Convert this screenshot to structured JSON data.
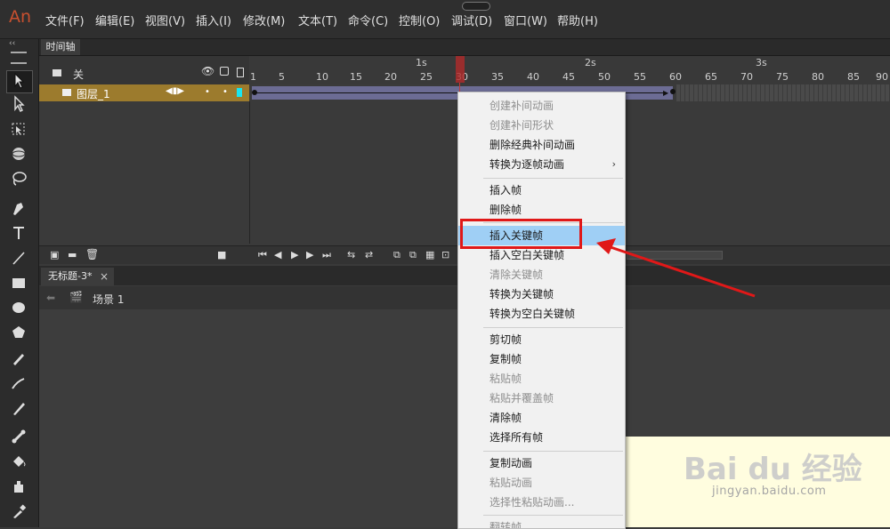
{
  "app": {
    "logo": "An"
  },
  "menubar": {
    "items": [
      "文件(F)",
      "编辑(E)",
      "视图(V)",
      "插入(I)",
      "修改(M)",
      "文本(T)",
      "命令(C)",
      "控制(O)",
      "调试(D)",
      "窗口(W)",
      "帮助(H)"
    ]
  },
  "timeline": {
    "tab_label": "时间轴",
    "header_label": "关",
    "layer_name": "图层_1",
    "ruler_numbers": [
      "1",
      "5",
      "10",
      "15",
      "20",
      "25",
      "30",
      "35",
      "40",
      "45",
      "50",
      "55",
      "60",
      "65",
      "70",
      "75",
      "80",
      "85",
      "90"
    ],
    "ruler_seconds": [
      "1s",
      "2s",
      "3s"
    ],
    "current_frame": 30
  },
  "document": {
    "tab_label": "无标题-3*",
    "tab_close": "×",
    "scene_label": "场景 1"
  },
  "context_menu": {
    "items": [
      {
        "label": "创建补间动画",
        "disabled": true
      },
      {
        "label": "创建补间形状",
        "disabled": true
      },
      {
        "label": "删除经典补间动画",
        "disabled": false
      },
      {
        "label": "转换为逐帧动画",
        "disabled": false,
        "submenu": true
      },
      {
        "label": "插入帧",
        "disabled": false
      },
      {
        "label": "删除帧",
        "disabled": false
      },
      {
        "label": "插入关键帧",
        "disabled": false,
        "highlighted": true
      },
      {
        "label": "插入空白关键帧",
        "disabled": false
      },
      {
        "label": "清除关键帧",
        "disabled": true
      },
      {
        "label": "转换为关键帧",
        "disabled": false
      },
      {
        "label": "转换为空白关键帧",
        "disabled": false
      },
      {
        "label": "剪切帧",
        "disabled": false
      },
      {
        "label": "复制帧",
        "disabled": false
      },
      {
        "label": "粘贴帧",
        "disabled": true
      },
      {
        "label": "粘贴并覆盖帧",
        "disabled": true
      },
      {
        "label": "清除帧",
        "disabled": false
      },
      {
        "label": "选择所有帧",
        "disabled": false
      },
      {
        "label": "复制动画",
        "disabled": false
      },
      {
        "label": "粘贴动画",
        "disabled": true
      },
      {
        "label": "选择性粘贴动画...",
        "disabled": true
      },
      {
        "label": "翻转帧",
        "disabled": true
      }
    ],
    "submenu_arrow": "›"
  },
  "watermark": {
    "logo": "Bai du 经验",
    "url": "jingyan.baidu.com"
  },
  "colors": {
    "highlight": "#9fcff5",
    "annotation": "#e01818",
    "layer_bar": "#9c7b2d",
    "tween": "#6c6c94"
  }
}
